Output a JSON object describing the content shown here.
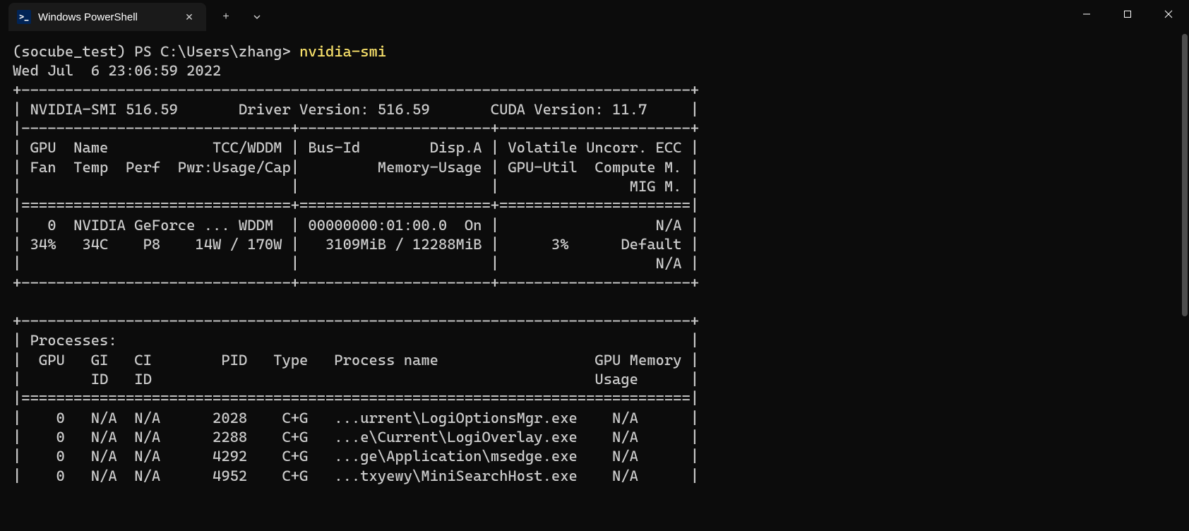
{
  "window": {
    "tab_title": "Windows PowerShell"
  },
  "prompt": {
    "env": "(socube_test) ",
    "path": "PS C:\\Users\\zhang> ",
    "command": "nvidia-smi"
  },
  "output": {
    "timestamp": "Wed Jul  6 23:06:59 2022",
    "border_top": "+-----------------------------------------------------------------------------+",
    "header1": "| NVIDIA-SMI 516.59       Driver Version: 516.59       CUDA Version: 11.7     |",
    "header_sep": "|-------------------------------+----------------------+----------------------+",
    "col_h1": "| GPU  Name            TCC/WDDM | Bus-Id        Disp.A | Volatile Uncorr. ECC |",
    "col_h2": "| Fan  Temp  Perf  Pwr:Usage/Cap|         Memory-Usage | GPU-Util  Compute M. |",
    "col_h3": "|                               |                      |               MIG M. |",
    "thick_sep": "|===============================+======================+======================|",
    "gpu_r1": "|   0  NVIDIA GeForce ... WDDM  | 00000000:01:00.0  On |                  N/A |",
    "gpu_r2": "| 34%   34C    P8    14W / 170W |   3109MiB / 12288MiB |      3%      Default |",
    "gpu_r3": "|                               |                      |                  N/A |",
    "border_bot": "+-------------------------------+----------------------+----------------------+",
    "blank": "                                                                               ",
    "p_top": "+-----------------------------------------------------------------------------+",
    "p_title": "| Processes:                                                                  |",
    "p_h1": "|  GPU   GI   CI        PID   Type   Process name                  GPU Memory |",
    "p_h2": "|        ID   ID                                                   Usage      |",
    "p_sep": "|=============================================================================|",
    "p_r1": "|    0   N/A  N/A      2028    C+G   ...urrent\\LogiOptionsMgr.exe    N/A      |",
    "p_r2": "|    0   N/A  N/A      2288    C+G   ...e\\Current\\LogiOverlay.exe    N/A      |",
    "p_r3": "|    0   N/A  N/A      4292    C+G   ...ge\\Application\\msedge.exe    N/A      |",
    "p_r4": "|    0   N/A  N/A      4952    C+G   ...txyewy\\MiniSearchHost.exe    N/A      |"
  }
}
